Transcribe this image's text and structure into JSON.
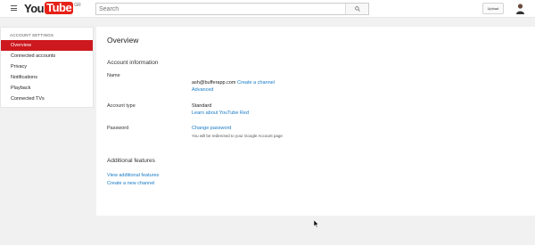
{
  "header": {
    "logo_you": "You",
    "logo_tube": "Tube",
    "logo_country": "GR",
    "search_placeholder": "Search",
    "upload_label": "Upload"
  },
  "sidebar": {
    "heading": "ACCOUNT SETTINGS",
    "items": [
      {
        "label": "Overview",
        "active": true
      },
      {
        "label": "Connected accounts"
      },
      {
        "label": "Privacy"
      },
      {
        "label": "Notifications"
      },
      {
        "label": "Playback"
      },
      {
        "label": "Connected TVs"
      }
    ]
  },
  "main": {
    "title": "Overview",
    "account_info_heading": "Account information",
    "name_label": "Name",
    "name_email": "ash@bufferapp.com",
    "create_channel_link": "Create a channel",
    "advanced_link": "Advanced",
    "account_type_label": "Account type",
    "account_type_value": "Standard",
    "learn_more_link": "Learn about YouTube Red",
    "password_label": "Password",
    "change_password_link": "Change password",
    "password_note": "You will be redirected to your Google Account page",
    "additional_heading": "Additional features",
    "view_features_link": "View additional features",
    "create_new_channel_link": "Create a new channel"
  },
  "icons": {
    "menu": "menu-icon",
    "search": "search-icon",
    "cursor": "mouse-cursor-icon"
  }
}
